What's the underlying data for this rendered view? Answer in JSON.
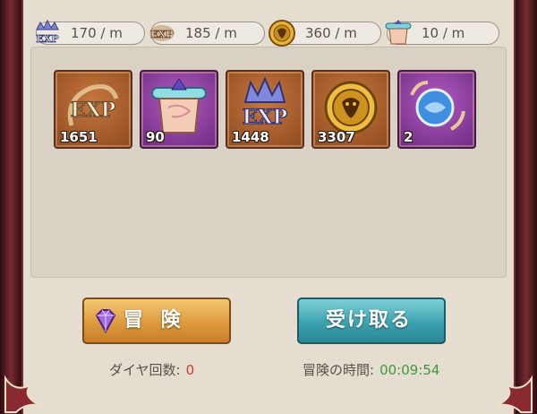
{
  "rates": [
    {
      "icon": "hero-exp-icon",
      "value": "170 / m"
    },
    {
      "icon": "exp-icon",
      "value": "185 / m"
    },
    {
      "icon": "gold-coin-icon",
      "value": "360 / m"
    },
    {
      "icon": "scroll-icon",
      "value": "10 / m"
    }
  ],
  "rewards": [
    {
      "icon": "exp-icon",
      "count": "1651"
    },
    {
      "icon": "scroll-icon",
      "count": "90"
    },
    {
      "icon": "hero-exp-icon",
      "count": "1448"
    },
    {
      "icon": "gold-coin-icon",
      "count": "3307"
    },
    {
      "icon": "spirit-orb-icon",
      "count": "2"
    }
  ],
  "buttons": {
    "adventure": "冒 険",
    "claim": "受け取る"
  },
  "stats": {
    "diamond_label": "ダイヤ回数:",
    "diamond_value": "0",
    "time_label": "冒険の時間:",
    "time_value": "00:09:54"
  },
  "colors": {
    "diamond_value": "#d23a2a",
    "time_value": "#3f9a3a"
  }
}
